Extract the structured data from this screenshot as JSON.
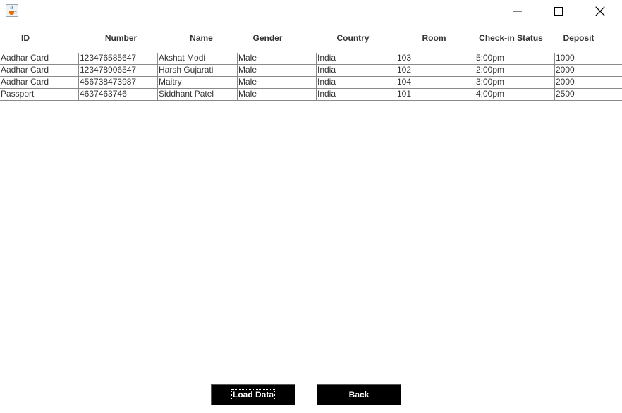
{
  "window": {
    "icon": "java-cup-icon",
    "controls": [
      "minimize-icon",
      "maximize-icon",
      "close-icon"
    ]
  },
  "table": {
    "headers": [
      "ID",
      "Number",
      "Name",
      "Gender",
      "Country",
      "Room",
      "Check-in Status",
      "Deposit"
    ],
    "rows": [
      [
        "Aadhar Card",
        "123476585647",
        "Akshat Modi",
        "Male",
        "India",
        "103",
        "5:00pm",
        "1000"
      ],
      [
        "Aadhar Card",
        "123478906547",
        "Harsh Gujarati",
        "Male",
        "India",
        "102",
        "2:00pm",
        "2000"
      ],
      [
        "Aadhar Card",
        "456738473987",
        "Maitry",
        "Male",
        "India",
        "104",
        "3:00pm",
        "2000"
      ],
      [
        "Passport",
        "4637463746",
        "Siddhant Patel",
        "Male",
        "India",
        "101",
        "4:00pm",
        "2500"
      ]
    ]
  },
  "buttons": {
    "load_data": "Load Data",
    "back": "Back"
  }
}
